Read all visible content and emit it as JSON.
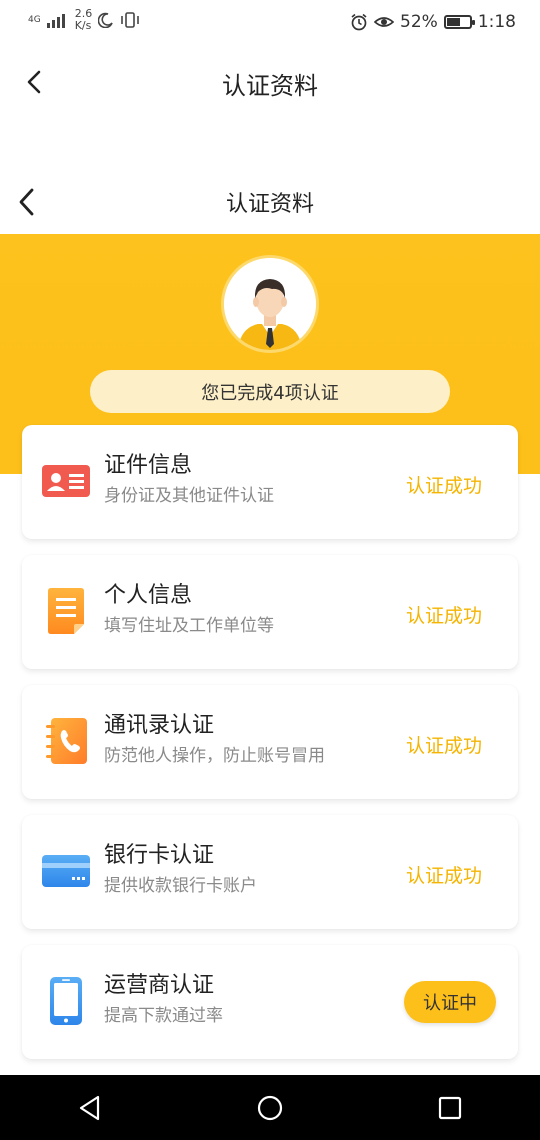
{
  "status_bar": {
    "network": "4G",
    "speed_value": "2.6",
    "speed_unit": "K/s",
    "battery": "52%",
    "time": "1:18"
  },
  "header": {
    "title": "认证资料"
  },
  "subheader": {
    "title": "认证资料"
  },
  "banner": {
    "summary": "您已完成4项认证",
    "color": "#fdc21d"
  },
  "cards": [
    {
      "title": "证件信息",
      "subtitle": "身份证及其他证件认证",
      "status": "认证成功",
      "icon": "id-card-icon"
    },
    {
      "title": "个人信息",
      "subtitle": "填写住址及工作单位等",
      "status": "认证成功",
      "icon": "document-icon"
    },
    {
      "title": "通讯录认证",
      "subtitle": "防范他人操作，防止账号冒用",
      "status": "认证成功",
      "icon": "phonebook-icon"
    },
    {
      "title": "银行卡认证",
      "subtitle": "提供收款银行卡账户",
      "status": "认证成功",
      "icon": "bank-card-icon"
    },
    {
      "title": "运营商认证",
      "subtitle": "提高下款通过率",
      "status": "认证中",
      "icon": "mobile-phone-icon"
    }
  ],
  "colors": {
    "accent": "#fdbf19",
    "success_text": "#f5b400"
  }
}
